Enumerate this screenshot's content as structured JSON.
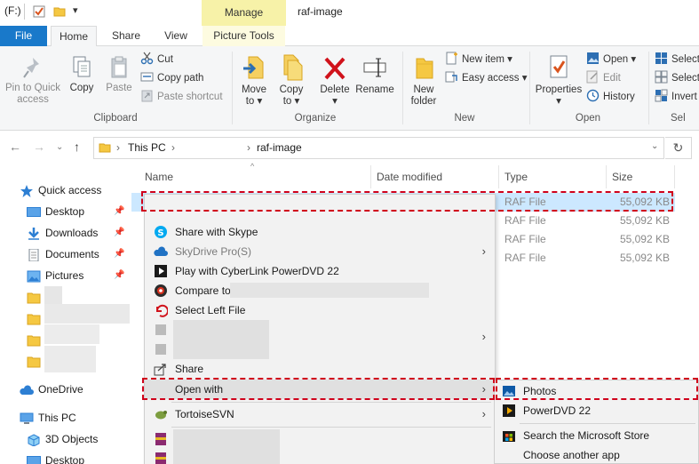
{
  "titlebar": {
    "drive_label": "(F:)",
    "manage_label": "Manage",
    "window_title": "raf-image"
  },
  "tabs": {
    "file": "File",
    "home": "Home",
    "share": "Share",
    "view": "View",
    "picture_tools": "Picture Tools"
  },
  "ribbon": {
    "clipboard": {
      "pin": "Pin to Quick access",
      "pin_l1": "Pin to Quick",
      "pin_l2": "access",
      "copy": "Copy",
      "paste": "Paste",
      "cut": "Cut",
      "copy_path": "Copy path",
      "paste_shortcut": "Paste shortcut",
      "label": "Clipboard"
    },
    "organize": {
      "move_l1": "Move",
      "move_l2": "to",
      "copy_l1": "Copy",
      "copy_l2": "to",
      "delete": "Delete",
      "rename": "Rename",
      "label": "Organize"
    },
    "new": {
      "folder_l1": "New",
      "folder_l2": "folder",
      "new_item": "New item",
      "easy_access": "Easy access",
      "label": "New"
    },
    "open": {
      "properties": "Properties",
      "open": "Open",
      "edit": "Edit",
      "history": "History",
      "label": "Open"
    },
    "select": {
      "select_all": "Select",
      "select_none": "Select",
      "invert": "Invert",
      "label": "Sel"
    }
  },
  "address": {
    "this_pc": "This PC",
    "folder": "raf-image",
    "sep": "›"
  },
  "nav": {
    "quick_access": "Quick access",
    "desktop": "Desktop",
    "downloads": "Downloads",
    "documents": "Documents",
    "pictures": "Pictures",
    "onedrive": "OneDrive",
    "this_pc": "This PC",
    "objects3d": "3D Objects",
    "desktop2": "Desktop"
  },
  "columns": {
    "name": "Name",
    "date_modified": "Date modified",
    "type": "Type",
    "size": "Size"
  },
  "files": [
    {
      "type": "RAF File",
      "size": "55,092 KB"
    },
    {
      "type": "RAF File",
      "size": "55,092 KB"
    },
    {
      "type": "RAF File",
      "size": "55,092 KB"
    },
    {
      "type": "RAF File",
      "size": "55,092 KB"
    }
  ],
  "context_menu": {
    "share_skype": "Share with Skype",
    "skydrive": "SkyDrive Pro(S)",
    "cyberlink": "Play with CyberLink PowerDVD 22",
    "compare": "Compare to",
    "select_left": "Select Left File",
    "share": "Share",
    "open_with": "Open with",
    "tortoise": "TortoiseSVN"
  },
  "submenu": {
    "photos": "Photos",
    "powerdvd": "PowerDVD 22",
    "store": "Search the Microsoft Store",
    "another": "Choose another app"
  },
  "colors": {
    "accent": "#1979ca",
    "selection": "#cce8ff",
    "highlight_dash": "#d0021b",
    "manage_tab": "#f7f2a8"
  }
}
